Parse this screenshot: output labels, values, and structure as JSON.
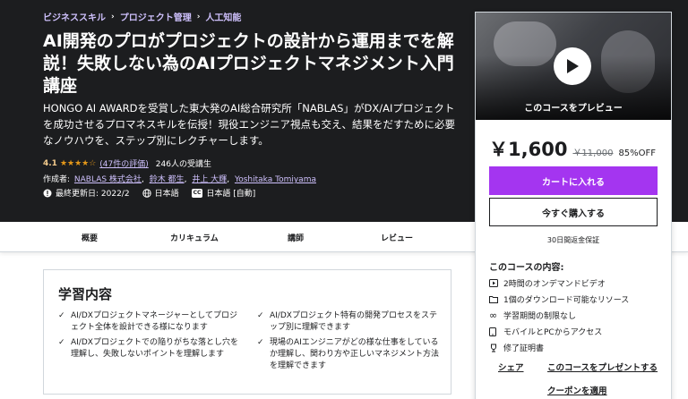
{
  "breadcrumb": [
    "ビジネススキル",
    "プロジェクト管理",
    "人工知能"
  ],
  "course": {
    "title": "AI開発のプロがプロジェクトの設計から運用までを解説！失敗しない為のAIプロジェクトマネジメント入門講座",
    "subtitle": "HONGO AI AWARDを受賞した東大発のAI総合研究所「NABLAS」がDX/AIプロジェクトを成功させるプロマネスキルを伝授！現役エンジニア視点も交え、結果をだすために必要なノウハウを、ステップ別にレクチャーします。",
    "rating": "4.1",
    "stars": "★★★★☆",
    "rating_count": "(47件の評価)",
    "students": "246人の受講生",
    "author_label": "作成者:",
    "authors": [
      "NABLAS 株式会社",
      "鈴木 都生",
      "井上 大輝",
      "Yoshitaka Tomiyama"
    ],
    "updated": "最終更新日: 2022/2",
    "language": "日本語",
    "cc_badge": "CC",
    "captions": "日本語 [自動]"
  },
  "tabs": [
    "概要",
    "カリキュラム",
    "講師",
    "レビュー"
  ],
  "learn": {
    "title": "学習内容",
    "items": [
      "AI/DXプロジェクトマネージャーとしてプロジェクト全体を設計できる様になります",
      "AI/DXプロジェクト特有の開発プロセスをステップ別に理解できます",
      "AI/DXプロジェクトでの陥りがちな落とし穴を理解し、失敗しないポイントを理解します",
      "現場のAIエンジニアがどの様な仕事をしているか理解し、関わり方や正しいマネジメント方法を理解できます"
    ]
  },
  "sidebar": {
    "preview_label": "このコースをプレビュー",
    "price": "￥1,600",
    "old_price": "￥11,000",
    "discount": "85%OFF",
    "cart_button": "カートに入れる",
    "buy_button": "今すぐ購入する",
    "guarantee": "30日間返金保証",
    "includes_title": "このコースの内容:",
    "includes": [
      {
        "icon": "video-icon",
        "text": "2時間のオンデマンドビデオ"
      },
      {
        "icon": "file-icon",
        "text": "1個のダウンロード可能なリソース"
      },
      {
        "icon": "infinity-icon",
        "text": "学習期間の制限なし"
      },
      {
        "icon": "mobile-icon",
        "text": "モバイルとPCからアクセス"
      },
      {
        "icon": "trophy-icon",
        "text": "修了証明書"
      }
    ],
    "share": "シェア",
    "gift": "このコースをプレゼントする",
    "coupon": "クーポンを適用"
  },
  "colors": {
    "hero_bg": "#1c1d1f",
    "accent_purple": "#a435f0",
    "link_purple": "#cec0fc",
    "star_orange": "#e59819"
  }
}
